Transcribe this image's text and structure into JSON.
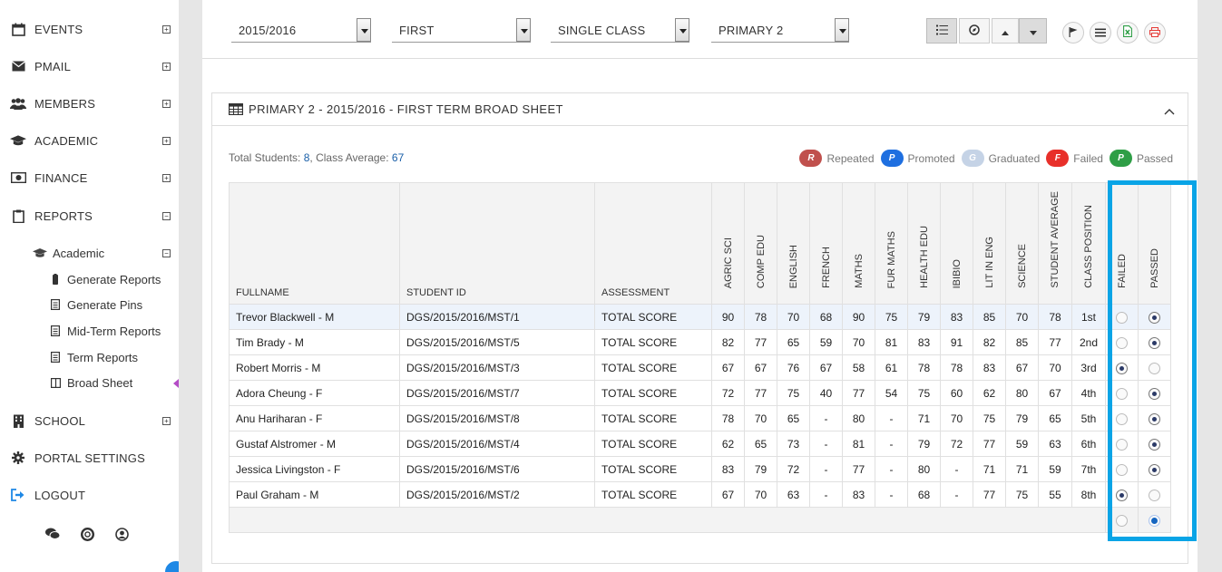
{
  "sidebar": {
    "items": [
      {
        "label": "EVENTS",
        "toggle": "+"
      },
      {
        "label": "PMAIL",
        "toggle": "+"
      },
      {
        "label": "MEMBERS",
        "toggle": "+"
      },
      {
        "label": "ACADEMIC",
        "toggle": "+"
      },
      {
        "label": "FINANCE",
        "toggle": "+"
      },
      {
        "label": "REPORTS",
        "toggle": "−"
      },
      {
        "label": "SCHOOL",
        "toggle": "+"
      },
      {
        "label": "PORTAL SETTINGS"
      },
      {
        "label": "LOGOUT"
      }
    ],
    "reports_sub": {
      "academic_label": "Academic",
      "academic_toggle": "−",
      "children": [
        "Generate Reports",
        "Generate Pins",
        "Mid-Term Reports",
        "Term Reports",
        "Broad Sheet"
      ]
    }
  },
  "toolbar": {
    "session": "2015/2016",
    "term": "FIRST",
    "mode": "SINGLE CLASS",
    "class": "PRIMARY 2"
  },
  "panel": {
    "title": "PRIMARY 2 - 2015/2016 - FIRST TERM BROAD SHEET",
    "summary_total_label": "Total Students: ",
    "summary_total": "8",
    "summary_avg_label": ", Class Average: ",
    "summary_avg": "67"
  },
  "legend": [
    {
      "key": "R",
      "label": "Repeated",
      "color": "#c0504d"
    },
    {
      "key": "P",
      "label": "Promoted",
      "color": "#1e6fe0"
    },
    {
      "key": "G",
      "label": "Graduated",
      "color": "#c5d3e6"
    },
    {
      "key": "F",
      "label": "Failed",
      "color": "#e8302a"
    },
    {
      "key": "P",
      "label": "Passed",
      "color": "#2e9e46"
    }
  ],
  "table": {
    "headers": [
      "FULLNAME",
      "STUDENT ID",
      "ASSESSMENT",
      "AGRIC SCI",
      "COMP EDU",
      "ENGLISH",
      "FRENCH",
      "MATHS",
      "FUR MATHS",
      "HEALTH EDU",
      "IBIBIO",
      "LIT IN ENG",
      "SCIENCE",
      "STUDENT AVERAGE",
      "CLASS POSITION",
      "FAILED",
      "PASSED"
    ],
    "rows": [
      {
        "name": "Trevor  Blackwell - M",
        "id": "DGS/2015/2016/MST/1",
        "assessment": "TOTAL SCORE",
        "scores": [
          "90",
          "78",
          "70",
          "68",
          "90",
          "75",
          "79",
          "83",
          "85",
          "70"
        ],
        "average": "78",
        "position": "1st",
        "status": "passed"
      },
      {
        "name": "Tim  Brady - M",
        "id": "DGS/2015/2016/MST/5",
        "assessment": "TOTAL SCORE",
        "scores": [
          "82",
          "77",
          "65",
          "59",
          "70",
          "81",
          "83",
          "91",
          "82",
          "85"
        ],
        "average": "77",
        "position": "2nd",
        "status": "passed"
      },
      {
        "name": "Robert  Morris - M",
        "id": "DGS/2015/2016/MST/3",
        "assessment": "TOTAL SCORE",
        "scores": [
          "67",
          "67",
          "76",
          "67",
          "58",
          "61",
          "78",
          "78",
          "83",
          "67"
        ],
        "average": "70",
        "position": "3rd",
        "status": "failed"
      },
      {
        "name": "Adora  Cheung - F",
        "id": "DGS/2015/2016/MST/7",
        "assessment": "TOTAL SCORE",
        "scores": [
          "72",
          "77",
          "75",
          "40",
          "77",
          "54",
          "75",
          "60",
          "62",
          "80"
        ],
        "average": "67",
        "position": "4th",
        "status": "passed"
      },
      {
        "name": "Anu  Hariharan - F",
        "id": "DGS/2015/2016/MST/8",
        "assessment": "TOTAL SCORE",
        "scores": [
          "78",
          "70",
          "65",
          "-",
          "80",
          "-",
          "71",
          "70",
          "75",
          "79"
        ],
        "average": "65",
        "position": "5th",
        "status": "passed"
      },
      {
        "name": "Gustaf  Alstromer - M",
        "id": "DGS/2015/2016/MST/4",
        "assessment": "TOTAL SCORE",
        "scores": [
          "62",
          "65",
          "73",
          "-",
          "81",
          "-",
          "79",
          "72",
          "77",
          "59"
        ],
        "average": "63",
        "position": "6th",
        "status": "passed"
      },
      {
        "name": "Jessica  Livingston - F",
        "id": "DGS/2015/2016/MST/6",
        "assessment": "TOTAL SCORE",
        "scores": [
          "83",
          "79",
          "72",
          "-",
          "77",
          "-",
          "80",
          "-",
          "71",
          "71"
        ],
        "average": "59",
        "position": "7th",
        "status": "passed"
      },
      {
        "name": "Paul  Graham - M",
        "id": "DGS/2015/2016/MST/2",
        "assessment": "TOTAL SCORE",
        "scores": [
          "67",
          "70",
          "63",
          "-",
          "83",
          "-",
          "68",
          "-",
          "77",
          "75"
        ],
        "average": "55",
        "position": "8th",
        "status": "failed"
      }
    ]
  }
}
